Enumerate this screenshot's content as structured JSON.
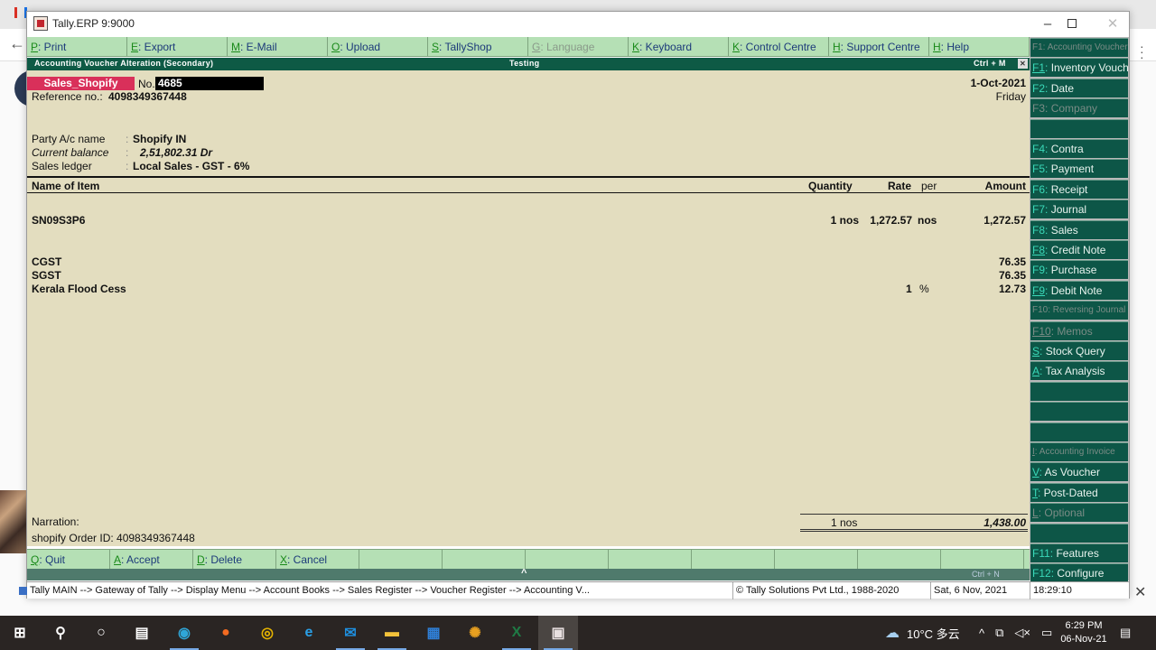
{
  "window": {
    "title": "Tally.ERP 9:9000",
    "minimize": "–",
    "close": "✕"
  },
  "top_buttons": [
    {
      "key": "P",
      "label": ": Print",
      "enabled": true
    },
    {
      "key": "E",
      "label": ": Export",
      "enabled": true
    },
    {
      "key": "M",
      "label": ": E-Mail",
      "enabled": true
    },
    {
      "key": "O",
      "label": ": Upload",
      "enabled": true
    },
    {
      "key": "S",
      "label": ": TallyShop",
      "enabled": true
    },
    {
      "key": "G",
      "label": ": Language",
      "enabled": false
    },
    {
      "key": "K",
      "label": ": Keyboard",
      "enabled": true
    },
    {
      "key": "K",
      "label": ": Control Centre",
      "enabled": true
    },
    {
      "key": "H",
      "label": ": Support Centre",
      "enabled": true
    },
    {
      "key": "H",
      "label": ": Help",
      "enabled": true
    }
  ],
  "header": {
    "screen_title": "Accounting Voucher  Alteration  (Secondary)",
    "company": "Testing",
    "shortcut": "Ctrl + M",
    "close_glyph": "✕"
  },
  "voucher": {
    "type": "Sales_Shopify",
    "no_label": "No.",
    "number": "4685",
    "date": "1-Oct-2021",
    "day": "Friday",
    "reference_label": "Reference no.:",
    "reference_value": "4098349367448",
    "party_label": "Party A/c name",
    "party_value": "Shopify IN",
    "balance_label": "Current balance",
    "balance_value": "2,51,802.31 Dr",
    "ledger_label": "Sales ledger",
    "ledger_value": "Local Sales - GST - 6%",
    "colon": ":"
  },
  "columns": {
    "name": "Name of Item",
    "quantity": "Quantity",
    "rate": "Rate",
    "per": "per",
    "amount": "Amount"
  },
  "items": [
    {
      "name": "SN09S3P6",
      "quantity": "1 nos",
      "rate": "1,272.57",
      "per": "nos",
      "amount": "1,272.57"
    }
  ],
  "taxes": [
    {
      "name": "CGST",
      "rate": "",
      "per": "",
      "amount": "76.35"
    },
    {
      "name": "SGST",
      "rate": "",
      "per": "",
      "amount": "76.35"
    },
    {
      "name": "Kerala Flood Cess",
      "rate": "1",
      "per": "%",
      "amount": "12.73"
    }
  ],
  "narration": {
    "label": "Narration:",
    "value": "shopify Order ID: 4098349367448"
  },
  "totals": {
    "quantity": "1 nos",
    "amount": "1,438.00"
  },
  "bottom_buttons": [
    {
      "key": "Q",
      "label": ": Quit"
    },
    {
      "key": "A",
      "label": ": Accept"
    },
    {
      "key": "D",
      "label": ": Delete"
    },
    {
      "key": "X",
      "label": ": Cancel"
    },
    {
      "key": "",
      "label": ""
    },
    {
      "key": "",
      "label": ""
    },
    {
      "key": "",
      "label": ""
    },
    {
      "key": "",
      "label": ""
    },
    {
      "key": "",
      "label": ""
    },
    {
      "key": "",
      "label": ""
    },
    {
      "key": "",
      "label": ""
    },
    {
      "key": "",
      "label": ""
    }
  ],
  "bottom_strip": {
    "caret": "^",
    "shortcut": "Ctrl + N"
  },
  "right_panel": [
    {
      "key": "F1",
      "label": "Accounting Vouchers",
      "enabled": false,
      "small": true
    },
    {
      "key": "F1",
      "label": "Inventory Vouchers",
      "enabled": true,
      "underline": true
    },
    {
      "key": "F2",
      "label": "Date",
      "enabled": true
    },
    {
      "key": "F3",
      "label": "Company",
      "enabled": false
    },
    {
      "key": "",
      "label": "",
      "enabled": true
    },
    {
      "key": "F4",
      "label": "Contra",
      "enabled": true
    },
    {
      "key": "F5",
      "label": "Payment",
      "enabled": true
    },
    {
      "key": "F6",
      "label": "Receipt",
      "enabled": true
    },
    {
      "key": "F7",
      "label": "Journal",
      "enabled": true
    },
    {
      "key": "F8",
      "label": "Sales",
      "enabled": true
    },
    {
      "key": "F8",
      "label": "Credit Note",
      "enabled": true,
      "underline": true
    },
    {
      "key": "F9",
      "label": "Purchase",
      "enabled": true
    },
    {
      "key": "F9",
      "label": "Debit Note",
      "enabled": true,
      "underline": true
    },
    {
      "key": "F10",
      "label": "Reversing Journal",
      "enabled": false,
      "small": true
    },
    {
      "key": "F10",
      "label": "Memos",
      "enabled": false,
      "underline": true
    },
    {
      "key": "S",
      "label": "Stock Query",
      "enabled": true,
      "underline": true
    },
    {
      "key": "A",
      "label": "Tax Analysis",
      "enabled": true,
      "underline": true
    },
    {
      "key": "",
      "label": "",
      "enabled": true
    },
    {
      "key": "",
      "label": "",
      "enabled": true
    },
    {
      "key": "",
      "label": "",
      "enabled": true
    },
    {
      "key": "I",
      "label": "Accounting Invoice",
      "enabled": false,
      "small": true,
      "underline": true
    },
    {
      "key": "V",
      "label": "As Voucher",
      "enabled": true,
      "underline": true
    },
    {
      "key": "T",
      "label": "Post-Dated",
      "enabled": true,
      "underline": true
    },
    {
      "key": "L",
      "label": "Optional",
      "enabled": false,
      "underline": true
    },
    {
      "key": "",
      "label": "",
      "enabled": true
    },
    {
      "key": "F11",
      "label": "Features",
      "enabled": true
    },
    {
      "key": "F12",
      "label": "Configure",
      "enabled": true
    }
  ],
  "status_bar": {
    "breadcrumb": "Tally MAIN --> Gateway of Tally --> Display Menu --> Account Books --> Sales Register --> Voucher Register --> Accounting V...",
    "copyright": "© Tally Solutions Pvt Ltd., 1988-2020",
    "date": "Sat, 6 Nov, 2021",
    "time": "18:29:10"
  },
  "taskbar": {
    "apps": [
      {
        "name": "start",
        "glyph": "⊞"
      },
      {
        "name": "search",
        "glyph": "⚲"
      },
      {
        "name": "cortana",
        "glyph": "○"
      },
      {
        "name": "task-view",
        "glyph": "▤"
      },
      {
        "name": "edge",
        "glyph": "◉",
        "color": "#2fa6d8"
      },
      {
        "name": "firefox",
        "glyph": "●",
        "color": "#f36b21"
      },
      {
        "name": "chrome",
        "glyph": "◎",
        "color": "#e6b400"
      },
      {
        "name": "internet-explorer",
        "glyph": "e",
        "color": "#2a9fe5"
      },
      {
        "name": "mail",
        "glyph": "✉",
        "color": "#1e90e0"
      },
      {
        "name": "file-explorer",
        "glyph": "▬",
        "color": "#f3c23a"
      },
      {
        "name": "store",
        "glyph": "▦",
        "color": "#2f7fd6"
      },
      {
        "name": "network-app",
        "glyph": "✺",
        "color": "#e8a020"
      },
      {
        "name": "excel",
        "glyph": "X",
        "color": "#1f7a45"
      },
      {
        "name": "tally",
        "glyph": "▣",
        "color": "#e8e0e0"
      }
    ],
    "weather": "10°C 多云",
    "time": "6:29 PM",
    "date": "06-Nov-21"
  }
}
